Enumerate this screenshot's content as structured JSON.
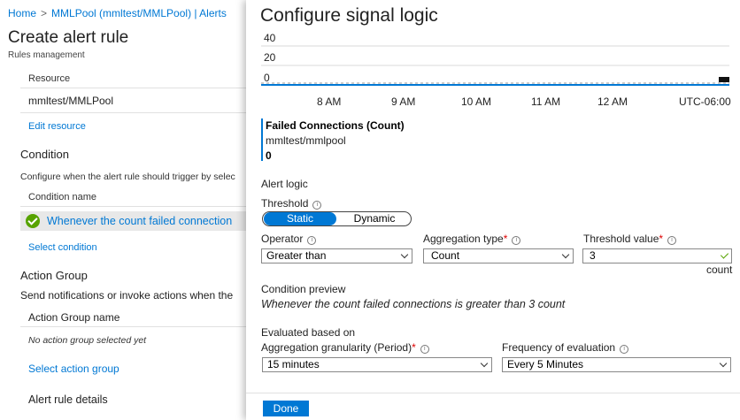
{
  "breadcrumb": {
    "home": "Home",
    "separator": ">",
    "current": "MMLPool (mmltest/MMLPool) | Alerts"
  },
  "page": {
    "title": "Create alert rule",
    "subtitle": "Rules management"
  },
  "resource": {
    "label": "Resource",
    "value": "mmltest/MMLPool",
    "edit_link": "Edit resource"
  },
  "condition": {
    "heading": "Condition",
    "description": "Configure when the alert rule should trigger by selec",
    "name_label": "Condition name",
    "item": "Whenever the count failed connection",
    "select_link": "Select condition"
  },
  "action_group": {
    "heading": "Action Group",
    "description": "Send notifications or invoke actions when the",
    "name_label": "Action Group name",
    "empty": "No action group selected yet",
    "select_link_prefix": "Select ",
    "select_link_suffix": "action group"
  },
  "details": {
    "heading": "Alert rule details"
  },
  "panel": {
    "title": "Configure signal logic",
    "chart": {
      "y_ticks": [
        "40",
        "20",
        "0"
      ],
      "x_ticks": [
        "8 AM",
        "9 AM",
        "10 AM",
        "11 AM",
        "12 AM"
      ],
      "timezone": "UTC-06:00"
    },
    "metric": {
      "name": "Failed Connections (Count)",
      "resource": "mmltest/mmlpool",
      "value": "0"
    },
    "alert_logic": "Alert logic",
    "threshold": {
      "label": "Threshold",
      "options": [
        "Static",
        "Dynamic"
      ],
      "selected": "Static"
    },
    "operator": {
      "label": "Operator",
      "value": "Greater than"
    },
    "aggregation": {
      "label": "Aggregation type",
      "value": "Count"
    },
    "threshold_value": {
      "label": "Threshold value",
      "value": "3",
      "unit": "count"
    },
    "preview": {
      "label": "Condition preview",
      "text": "Whenever the count failed connections is greater than 3 count"
    },
    "evaluated": {
      "label": "Evaluated based on",
      "granularity_label": "Aggregation granularity (Period)",
      "granularity_value": "15 minutes",
      "frequency_label": "Frequency of evaluation",
      "frequency_value": "Every 5 Minutes"
    },
    "done_label": "Done"
  },
  "colors": {
    "accent": "#0078d4",
    "success": "#57a300",
    "required": "#d00000"
  }
}
